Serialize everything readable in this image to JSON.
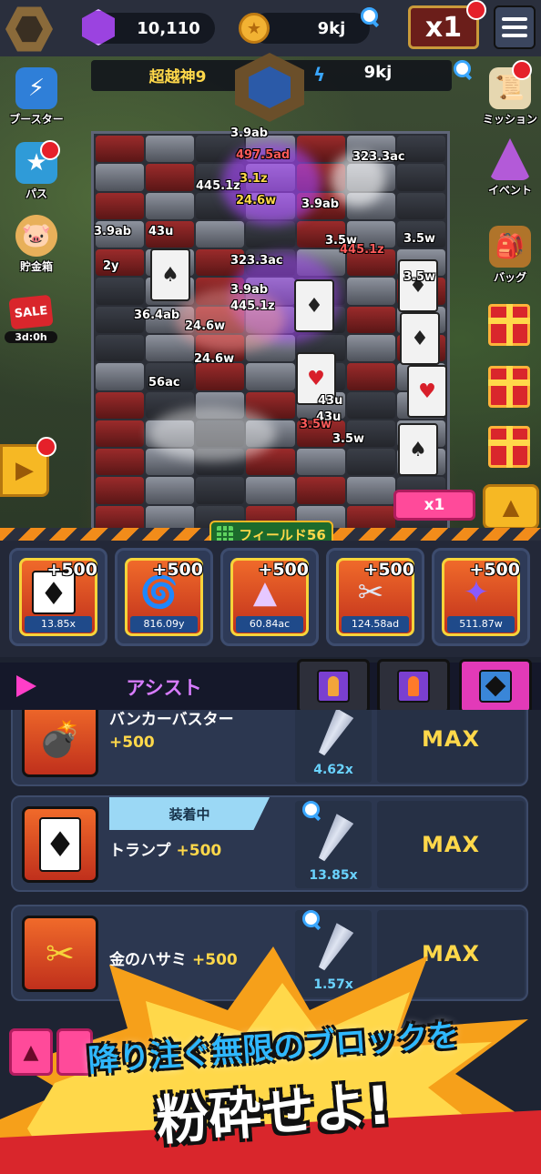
{
  "topbar": {
    "gems": "10,110",
    "coins": "9kj",
    "speed_label": "x1"
  },
  "stage": {
    "label": "超越神9",
    "power": "9kj"
  },
  "left_menu": {
    "booster": "ブースター",
    "pass": "パス",
    "piggy_bank": "貯金箱",
    "sale": "SALE",
    "sale_timer": "3d:0h"
  },
  "right_menu": {
    "mission": "ミッション",
    "event": "イベント",
    "bag": "バッグ"
  },
  "field_fx": {
    "numbers": [
      "3.9ab",
      "497.5ad",
      "3.1z",
      "24.6w",
      "445.1z",
      "323.3ac",
      "3.9ab",
      "43u",
      "3.9ab",
      "3.5w",
      "2y",
      "36.4ab",
      "24.6w",
      "445.1z",
      "3.5w",
      "3.5w",
      "3.9ab",
      "323.3ac",
      "56ac",
      "445.1z",
      "43u",
      "43u",
      "3.5w",
      "3.5w",
      "24.6w"
    ]
  },
  "x1_button": "x1",
  "field_tag": "フィールド56",
  "slots": [
    {
      "bonus": "+500",
      "mult": "13.85x",
      "glyph": "♦"
    },
    {
      "bonus": "+500",
      "mult": "816.09y",
      "glyph": "🌀"
    },
    {
      "bonus": "+500",
      "mult": "60.84ac",
      "glyph": "▲"
    },
    {
      "bonus": "+500",
      "mult": "124.58ad",
      "glyph": "✂"
    },
    {
      "bonus": "+500",
      "mult": "511.87w",
      "glyph": "✦"
    }
  ],
  "assist": {
    "label": "アシスト"
  },
  "list": [
    {
      "name": "バンカーバスター",
      "plus": "+500",
      "drill": "4.62x",
      "max": "MAX"
    },
    {
      "name": "トランプ",
      "plus": "+500",
      "drill": "13.85x",
      "max": "MAX",
      "equipped": "装着中"
    },
    {
      "name": "金のハサミ",
      "plus": "+500",
      "drill": "1.57x",
      "max": "MAX"
    }
  ],
  "promo": {
    "line1": "降り注ぐ無限のブロックを",
    "line2": "粉砕せよ!"
  }
}
